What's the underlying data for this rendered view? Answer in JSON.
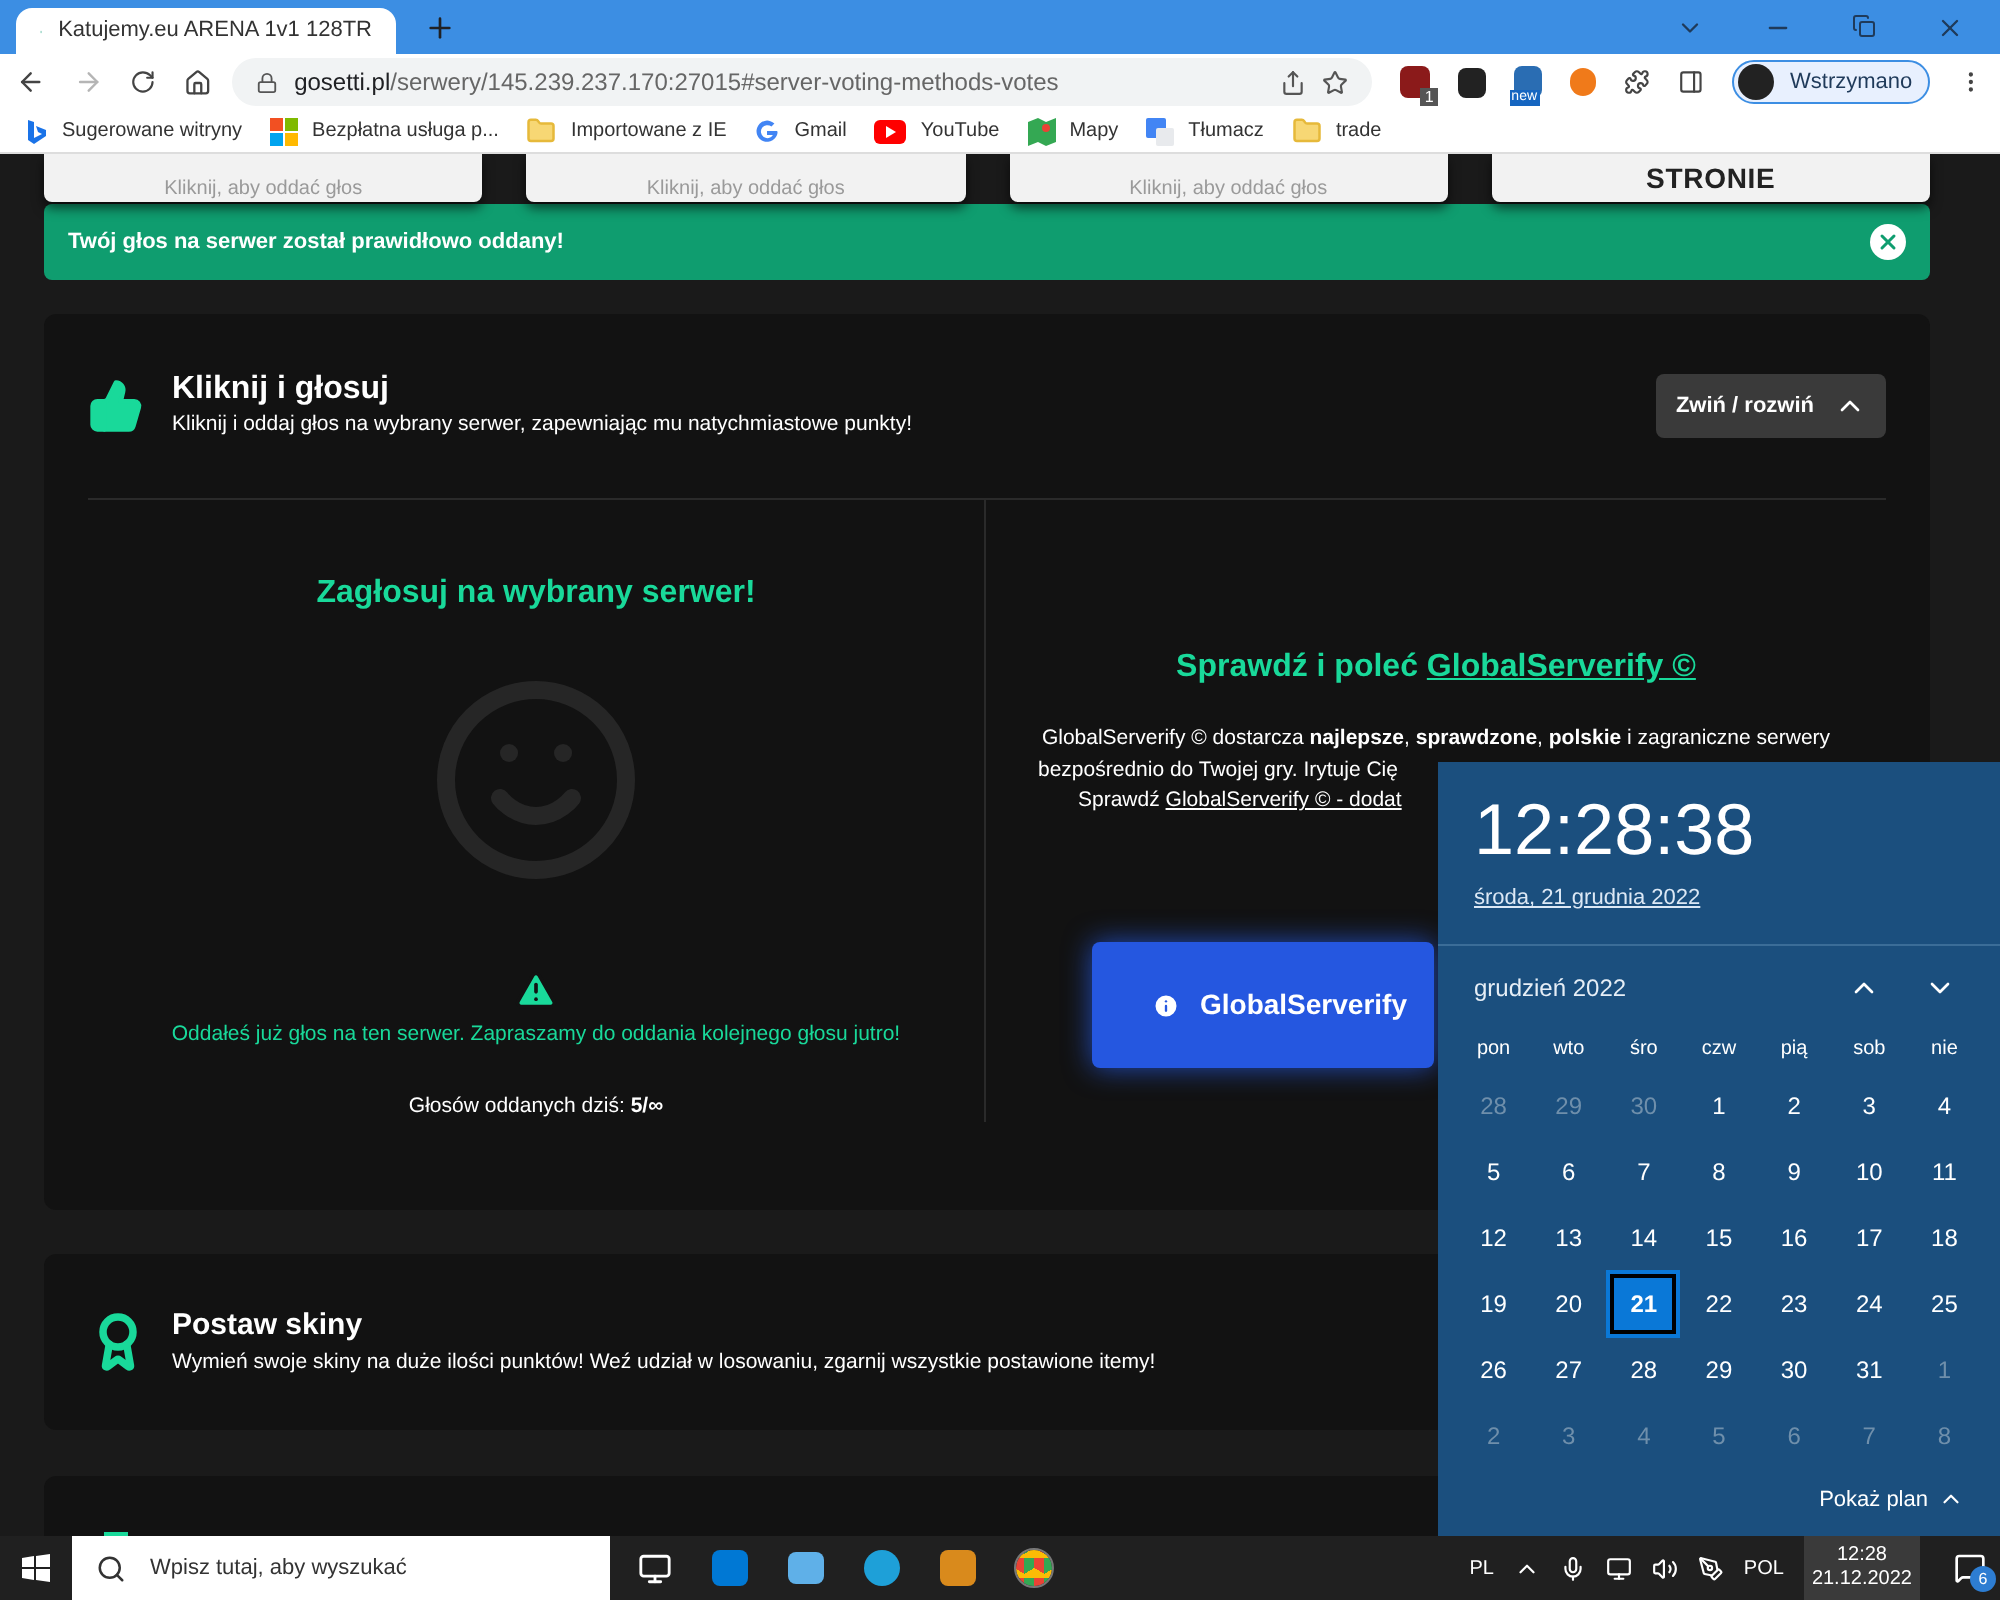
{
  "browser": {
    "tab_title": "Katujemy.eu ARENA 1v1 128TR",
    "url_host": "gosetti.pl",
    "url_path": "/serwery/145.239.237.170:27015#server-voting-methods-votes",
    "profile": "Wstrzymano",
    "extension_badges": [
      {
        "text": "1"
      },
      {
        "text": "new"
      }
    ],
    "bookmarks": [
      {
        "label": "Sugerowane witryny",
        "kind": "bing"
      },
      {
        "label": "Bezpłatna usługa p...",
        "kind": "ms"
      },
      {
        "label": "Importowane z IE",
        "kind": "folder"
      },
      {
        "label": "Gmail",
        "kind": "google"
      },
      {
        "label": "YouTube",
        "kind": "youtube"
      },
      {
        "label": "Mapy",
        "kind": "maps"
      },
      {
        "label": "Tłumacz",
        "kind": "translate"
      },
      {
        "label": "trade",
        "kind": "folder"
      }
    ]
  },
  "method_cards": [
    {
      "subtitle": "Kliknij, aby oddać głos"
    },
    {
      "subtitle": "Kliknij, aby oddać głos"
    },
    {
      "subtitle": "Kliknij, aby oddać głos"
    },
    {
      "title": "STRONIE"
    }
  ],
  "alert": {
    "text": "Twój głos na serwer został prawidłowo oddany!"
  },
  "vote_section": {
    "title": "Kliknij i głosuj",
    "subtitle": "Kliknij i oddaj głos na wybrany serwer, zapewniając mu natychmiastowe punkty!",
    "toggle": "Zwiń / rozwiń",
    "expanded": true,
    "left": {
      "heading": "Zagłosuj na wybrany serwer!",
      "warning": "Oddałeś już głos na ten serwer. Zapraszamy do oddania kolejnego głosu jutro!",
      "votes_label": "Głosów oddanych dziś:",
      "votes_value": "5/∞"
    },
    "right": {
      "heading": "Sprawdź i poleć",
      "heading_link": "GlobalServerify ©",
      "line_1": "GlobalServerify © dostarcza **najlepsze**, **sprawdzone**, **polskie** i zagraniczne serwery",
      "line_2": "bezpośrednio do Twojej gry. Irytuje Cię",
      "line_3": "Sprawdź",
      "line_3_link": "GlobalServerify © - dodat",
      "button": "GlobalServerify"
    }
  },
  "skins_section": {
    "title": "Postaw skiny",
    "subtitle": "Wymień swoje skiny na duże ilości punktów! Weź udział w losowaniu, zgarnij wszystkie postawione itemy!"
  },
  "calendar": {
    "time": "12:28:38",
    "date": "środa, 21 grudnia 2022",
    "month": "grudzień 2022",
    "weekdays": [
      "pon",
      "wto",
      "śro",
      "czw",
      "pią",
      "sob",
      "nie"
    ],
    "weeks": [
      [
        {
          "day": "28",
          "current": false,
          "selected": false
        },
        {
          "day": "29",
          "current": false,
          "selected": false
        },
        {
          "day": "30",
          "current": false,
          "selected": false
        },
        {
          "day": "1",
          "current": true,
          "selected": false
        },
        {
          "day": "2",
          "current": true,
          "selected": false
        },
        {
          "day": "3",
          "current": true,
          "selected": false
        },
        {
          "day": "4",
          "current": true,
          "selected": false
        }
      ],
      [
        {
          "day": "5",
          "current": true,
          "selected": false
        },
        {
          "day": "6",
          "current": true,
          "selected": false
        },
        {
          "day": "7",
          "current": true,
          "selected": false
        },
        {
          "day": "8",
          "current": true,
          "selected": false
        },
        {
          "day": "9",
          "current": true,
          "selected": false
        },
        {
          "day": "10",
          "current": true,
          "selected": false
        },
        {
          "day": "11",
          "current": true,
          "selected": false
        }
      ],
      [
        {
          "day": "12",
          "current": true,
          "selected": false
        },
        {
          "day": "13",
          "current": true,
          "selected": false
        },
        {
          "day": "14",
          "current": true,
          "selected": false
        },
        {
          "day": "15",
          "current": true,
          "selected": false
        },
        {
          "day": "16",
          "current": true,
          "selected": false
        },
        {
          "day": "17",
          "current": true,
          "selected": false
        },
        {
          "day": "18",
          "current": true,
          "selected": false
        }
      ],
      [
        {
          "day": "19",
          "current": true,
          "selected": false
        },
        {
          "day": "20",
          "current": true,
          "selected": false
        },
        {
          "day": "21",
          "current": true,
          "selected": true
        },
        {
          "day": "22",
          "current": true,
          "selected": false
        },
        {
          "day": "23",
          "current": true,
          "selected": false
        },
        {
          "day": "24",
          "current": true,
          "selected": false
        },
        {
          "day": "25",
          "current": true,
          "selected": false
        }
      ],
      [
        {
          "day": "26",
          "current": true,
          "selected": false
        },
        {
          "day": "27",
          "current": true,
          "selected": false
        },
        {
          "day": "28",
          "current": true,
          "selected": false
        },
        {
          "day": "29",
          "current": true,
          "selected": false
        },
        {
          "day": "30",
          "current": true,
          "selected": false
        },
        {
          "day": "31",
          "current": true,
          "selected": false
        },
        {
          "day": "1",
          "current": false,
          "selected": false
        }
      ],
      [
        {
          "day": "2",
          "current": false,
          "selected": false
        },
        {
          "day": "3",
          "current": false,
          "selected": false
        },
        {
          "day": "4",
          "current": false,
          "selected": false
        },
        {
          "day": "5",
          "current": false,
          "selected": false
        },
        {
          "day": "6",
          "current": false,
          "selected": false
        },
        {
          "day": "7",
          "current": false,
          "selected": false
        },
        {
          "day": "8",
          "current": false,
          "selected": false
        }
      ]
    ],
    "agenda_toggle": "Pokaż plan"
  },
  "taskbar": {
    "search_placeholder": "Wpisz tutaj, aby wyszukać",
    "keyboard": "PL",
    "language": "POL",
    "time": "12:28",
    "date": "21.12.2022",
    "notifications": "6"
  }
}
